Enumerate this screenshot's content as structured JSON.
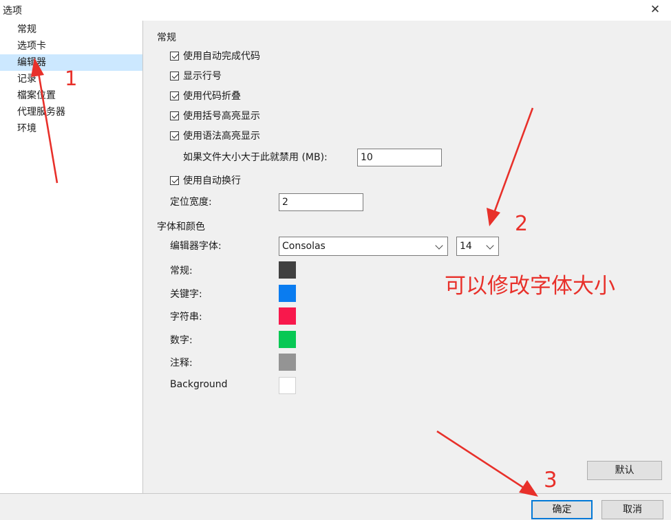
{
  "window": {
    "title": "选项",
    "close_glyph": "✕"
  },
  "sidebar": {
    "items": [
      {
        "label": "常规"
      },
      {
        "label": "选项卡"
      },
      {
        "label": "编辑器",
        "selected": true
      },
      {
        "label": "记录"
      },
      {
        "label": "檔案位置"
      },
      {
        "label": "代理服务器"
      },
      {
        "label": "环境"
      }
    ]
  },
  "editor": {
    "general_title": "常规",
    "options": [
      {
        "label": "使用自动完成代码",
        "checked": true
      },
      {
        "label": "显示行号",
        "checked": true
      },
      {
        "label": "使用代码折叠",
        "checked": true
      },
      {
        "label": "使用括号高亮显示",
        "checked": true
      },
      {
        "label": "使用语法高亮显示",
        "checked": true
      }
    ],
    "disable_if_larger_label": "如果文件大小大于此就禁用 (MB):",
    "disable_if_larger_value": "10",
    "word_wrap": {
      "label": "使用自动换行",
      "checked": true
    },
    "tab_width_label": "定位宽度:",
    "tab_width_value": "2",
    "font_section_title": "字体和颜色",
    "font_label": "编辑器字体:",
    "font_value": "Consolas",
    "font_size_value": "14",
    "colors": [
      {
        "label": "常规:",
        "color": "#404040"
      },
      {
        "label": "关键字:",
        "color": "#0a7cf0"
      },
      {
        "label": "字符串:",
        "color": "#f8184c"
      },
      {
        "label": "数字:",
        "color": "#08c854"
      },
      {
        "label": "注释:",
        "color": "#949494"
      },
      {
        "label": "Background",
        "color": "#ffffff"
      }
    ],
    "default_button": "默认"
  },
  "footer": {
    "ok_button": "确定",
    "cancel_button": "取消"
  },
  "annotations": {
    "marker_1": "1",
    "marker_2": "2",
    "marker_3": "3",
    "note": "可以修改字体大小",
    "color": "#e8302a"
  }
}
